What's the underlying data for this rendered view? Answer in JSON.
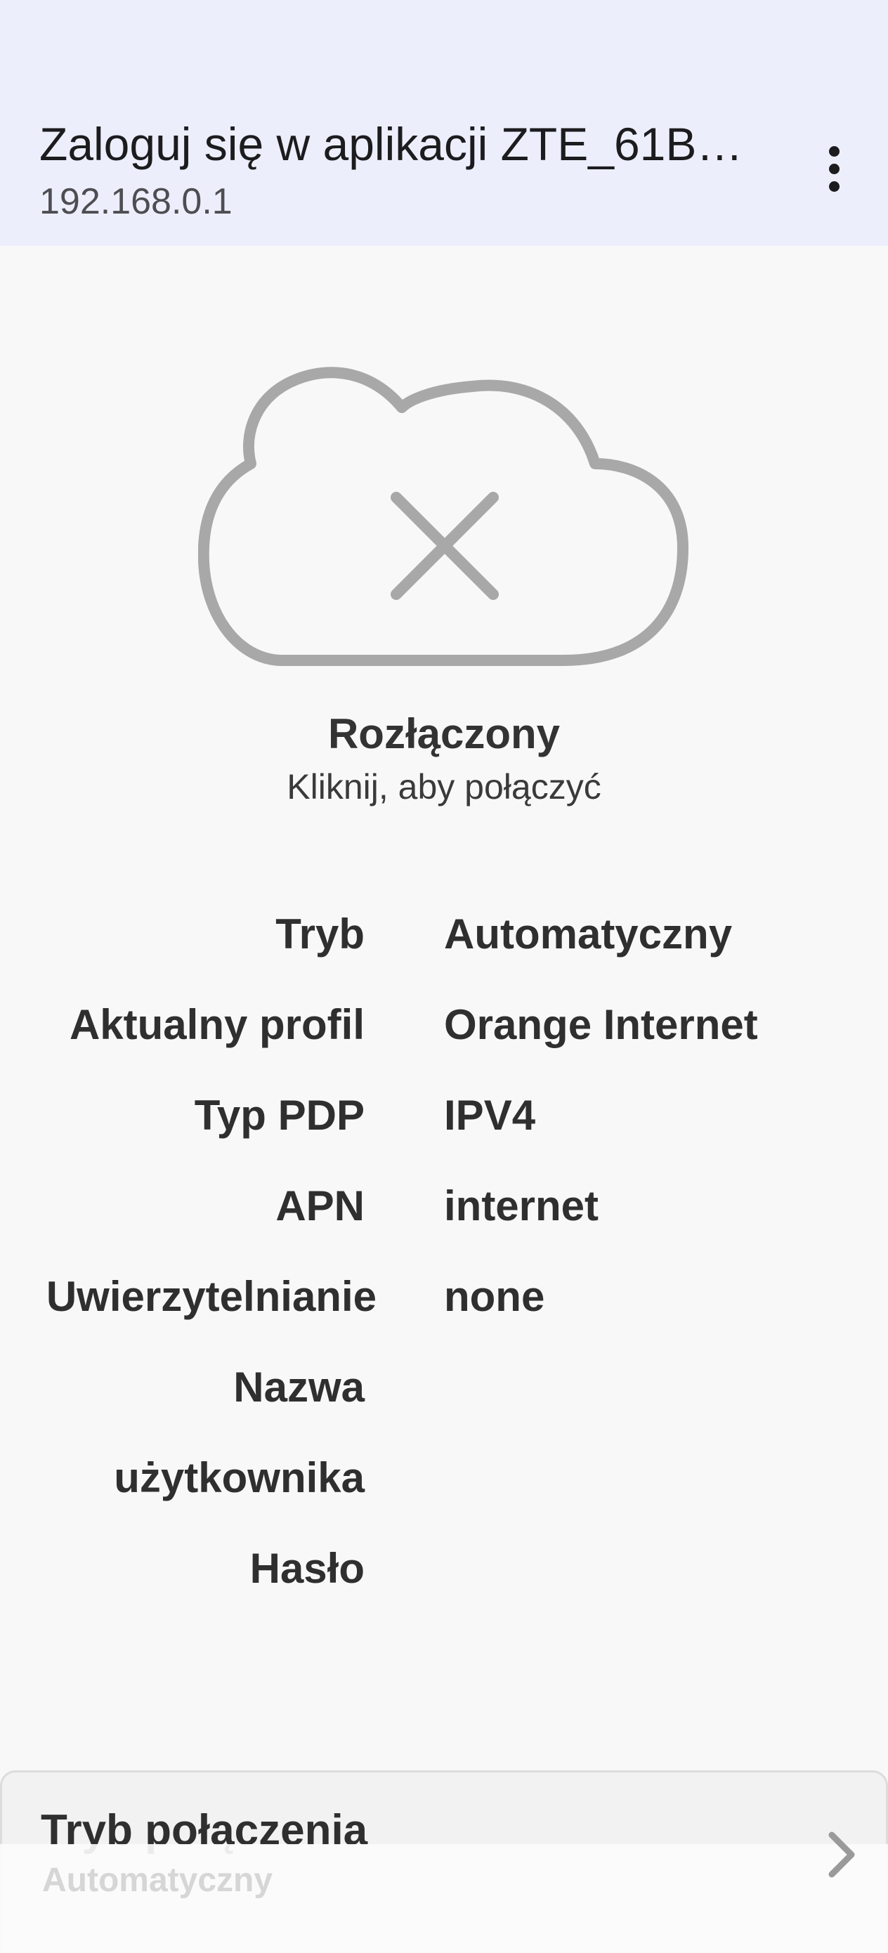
{
  "header": {
    "title": "Zaloguj się w aplikacji ZTE_61B…",
    "subtitle": "192.168.0.1",
    "menu_icon": "more-vert-icon"
  },
  "status": {
    "icon": "cloud-off-icon",
    "title": "Rozłączony",
    "subtitle": "Kliknij, aby połączyć"
  },
  "info": [
    {
      "label": "Tryb",
      "value": "Automatyczny"
    },
    {
      "label": "Aktualny profil",
      "value": "Orange Internet"
    },
    {
      "label": "Typ PDP",
      "value": "IPV4"
    },
    {
      "label": "APN",
      "value": "internet"
    },
    {
      "label": "Uwierzytelnianie",
      "value": "none"
    },
    {
      "label": "Nazwa",
      "value": ""
    },
    {
      "label": "użytkownika",
      "value": ""
    },
    {
      "label": "Hasło",
      "value": ""
    }
  ],
  "connection_mode": {
    "title": "Tryb połączenia",
    "value": "Automatyczny",
    "icon": "chevron-right-icon"
  }
}
